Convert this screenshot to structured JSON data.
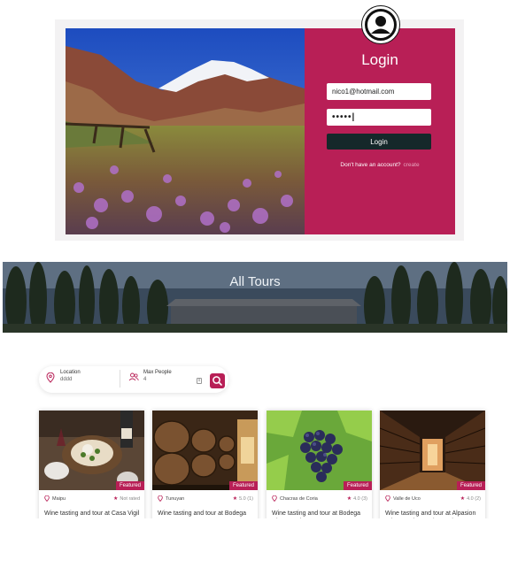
{
  "login": {
    "title": "Login",
    "email_value": "nico1@hotmail.com",
    "password_value": "•••••|",
    "button_label": "Login",
    "signup_prompt": "Don't have an account?",
    "signup_link": "create"
  },
  "banner": {
    "title": "All Tours"
  },
  "search": {
    "location_label": "Location",
    "location_value": "dddd",
    "people_label": "Max People",
    "people_value": "4",
    "stepper_glyph": "⇕"
  },
  "tours": [
    {
      "location": "Maipu",
      "rating": "Not rated",
      "badge": "Featured",
      "title": "Wine tasting and tour at Casa Vigil"
    },
    {
      "location": "Tunuyan",
      "rating": "5.0 (1)",
      "badge": "Featured",
      "title": "Wine tasting and tour at Bodega"
    },
    {
      "location": "Chacras de Coria",
      "rating": "4.0 (3)",
      "badge": "Featured",
      "title": "Wine tasting and tour at Bodega Clos De Chacras"
    },
    {
      "location": "Valle de Uco",
      "rating": "4.0 (2)",
      "badge": "Featured",
      "title": "Wine tasting and tour at Alpasion Wines Lodge & Vineyards"
    }
  ],
  "colors": {
    "accent": "#b81f56",
    "dark_button": "#15282a"
  }
}
